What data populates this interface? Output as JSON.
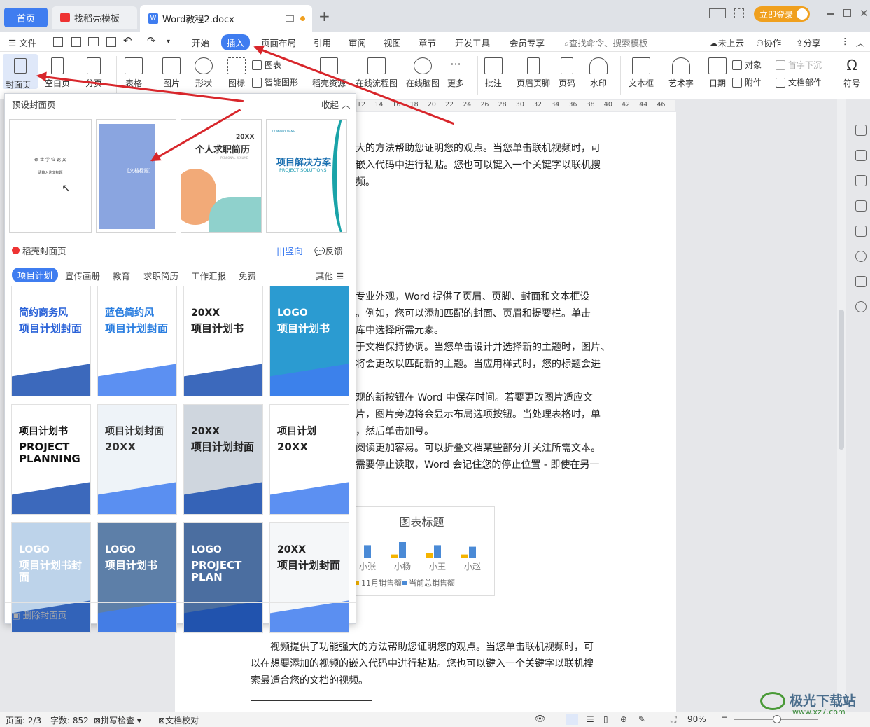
{
  "tabs": {
    "home": "首页",
    "templates": "找稻壳模板",
    "doc": "Word教程2.docx",
    "new_tab": "+"
  },
  "window": {
    "login_btn": "立即登录"
  },
  "menu": {
    "file": "文件",
    "start": "开始",
    "insert": "插入",
    "layout": "页面布局",
    "ref": "引用",
    "review": "审阅",
    "view": "视图",
    "chapter": "章节",
    "dev": "开发工具",
    "member": "会员专享",
    "search": "查找命令、搜索模板",
    "cloud": "未上云",
    "collab": "协作",
    "share": "分享"
  },
  "ribbon": {
    "cover": "封面页",
    "blank": "空白页",
    "pagebreak": "分页",
    "table": "表格",
    "picture": "图片",
    "shape": "形状",
    "icon": "图标",
    "chart": "图表",
    "smart": "智能图形",
    "daoke": "稻壳资源",
    "flow": "在线流程图",
    "mind": "在线脑图",
    "more": "更多",
    "comment": "批注",
    "headfoot": "页眉页脚",
    "pagenum": "页码",
    "watermark": "水印",
    "textbox": "文本框",
    "wordart": "艺术字",
    "date": "日期",
    "object": "对象",
    "attach": "附件",
    "dropcap": "首字下沉",
    "docpart": "文档部件",
    "symbol": "符号"
  },
  "panel": {
    "preset_title": "预设封面页",
    "collapse": "收起",
    "daoke_title": "稻壳封面页",
    "vertical": "竖向",
    "feedback": "反馈",
    "categories": [
      "项目计划",
      "宣传画册",
      "教育",
      "求职简历",
      "工作汇报",
      "免费"
    ],
    "other": "其他",
    "delete": "删除封面页"
  },
  "presets": [
    {
      "lines": [
        "硕 士 学 位 论 文",
        "请输入论文标题"
      ]
    },
    {
      "lines": [
        "[文档标题]"
      ]
    },
    {
      "lines": [
        "20XX",
        "个人求职简历",
        "PERSONAL RESUME"
      ]
    },
    {
      "lines": [
        "COMPANY NAME",
        "项目解决方案",
        "PROJECT SOLUTIONS"
      ]
    }
  ],
  "cards": [
    {
      "t1": "简约商务风",
      "t2": "项目计划封面",
      "color": "#2a62d8"
    },
    {
      "t1": "蓝色简约风",
      "t2": "项目计划封面",
      "color": "#2a7ee0"
    },
    {
      "t1": "20XX",
      "t2": "项目计划书",
      "color": "#222"
    },
    {
      "t1": "LOGO",
      "t2": "项目计划书",
      "color": "#fff"
    },
    {
      "t1": "项目计划书",
      "t2": "PROJECT PLANNING",
      "color": "#111"
    },
    {
      "t1": "项目计划封面",
      "t2": "20XX",
      "color": "#333"
    },
    {
      "t1": "20XX",
      "t2": "项目计划封面",
      "color": "#222"
    },
    {
      "t1": "项目计划",
      "t2": "20XX",
      "color": "#222"
    },
    {
      "t1": "LOGO",
      "t2": "项目计划书封面",
      "color": "#fff"
    },
    {
      "t1": "LOGO",
      "t2": "项目计划书",
      "color": "#fff"
    },
    {
      "t1": "LOGO",
      "t2": "PROJECT   PLAN",
      "color": "#fff"
    },
    {
      "t1": "20XX",
      "t2": "项目计划封面",
      "color": "#222"
    }
  ],
  "ruler": [
    "12",
    "14",
    "16",
    "18",
    "20",
    "22",
    "24",
    "26",
    "28",
    "30",
    "32",
    "34",
    "36",
    "38",
    "40",
    "42",
    "44",
    "46"
  ],
  "doc": {
    "p1": [
      "大的方法帮助您证明您的观点。当您单击联机视频时，可",
      "嵌入代码中进行粘贴。您也可以键入一个关键字以联机搜",
      "频。"
    ],
    "p2": [
      "专业外观，Word 提供了页眉、页脚、封面和文本框设",
      "。例如，您可以添加匹配的封面、页眉和提要栏。单击",
      "库中选择所需元素。",
      "于文档保持协调。当您单击设计并选择新的主题时，图片、",
      "将会更改以匹配新的主题。当应用样式时，您的标题会进"
    ],
    "p3": [
      "观的新按钮在 Word 中保存时间。若要更改图片适应文",
      "片，图片旁边将会显示布局选项按钮。当处理表格时，单",
      "，然后单击加号。",
      "阅读更加容易。可以折叠文档某些部分并关注所需文本。",
      "需要停止读取，Word 会记住您的停止位置 - 即使在另一"
    ],
    "p4": [
      "视频提供了功能强大的方法帮助您证明您的观点。当您单击联机视频时，可",
      "以在想要添加的视频的嵌入代码中进行粘贴。您也可以键入一个关键字以联机搜",
      "索最适合您的文档的视频。"
    ]
  },
  "chart_data": {
    "type": "bar",
    "title": "图表标题",
    "categories": [
      "小张",
      "小杨",
      "小王",
      "小赵"
    ],
    "series": [
      {
        "name": "11月销售额",
        "color": "#f5b400",
        "values": [
          null,
          2,
          3,
          2
        ]
      },
      {
        "name": "当前总销售额",
        "color": "#4a8ad6",
        "values": [
          8,
          10,
          8,
          7
        ]
      }
    ]
  },
  "status": {
    "page": "页面: 2/3",
    "words": "字数: 852",
    "spell": "拼写检查",
    "proof": "文档校对",
    "zoom": "90%"
  },
  "watermark": {
    "title": "极光下载站",
    "url": "www.xz7.com"
  }
}
